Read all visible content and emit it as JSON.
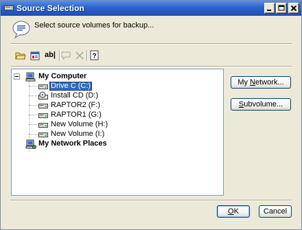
{
  "window": {
    "title": "Source Selection",
    "colors": {
      "titlebar": "#2c63c9",
      "selection": "#316ac5",
      "face": "#ece9d8"
    }
  },
  "header": {
    "instruction": "Select source volumes for backup...",
    "icon": "help-bubble-icon"
  },
  "toolbar": {
    "items": [
      {
        "icon": "folder-open-icon",
        "enabled": true
      },
      {
        "icon": "properties-icon",
        "enabled": true
      },
      {
        "icon": "rename-icon",
        "enabled": true
      },
      {
        "icon": "comment-icon",
        "enabled": false
      },
      {
        "icon": "delete-icon",
        "enabled": false
      },
      {
        "icon": "help-icon",
        "enabled": true
      }
    ],
    "rename_label": "ab|"
  },
  "tree": {
    "my_computer": "My Computer",
    "drives": [
      {
        "label": "Drive C (C:)",
        "selected": true
      },
      {
        "label": "Install CD (D:)",
        "selected": false
      },
      {
        "label": "RAPTOR2 (F:)",
        "selected": false
      },
      {
        "label": "RAPTOR1 (G:)",
        "selected": false
      },
      {
        "label": "New Volume (H:)",
        "selected": false
      },
      {
        "label": "New Volume (I:)",
        "selected": false
      }
    ],
    "network_places": "My Network Places"
  },
  "buttons": {
    "my_network_pre": "My ",
    "my_network_u": "N",
    "my_network_post": "etwork...",
    "subvolume_u": "S",
    "subvolume_post": "ubvolume...",
    "ok_u": "O",
    "ok_post": "K",
    "cancel": "Cancel"
  }
}
